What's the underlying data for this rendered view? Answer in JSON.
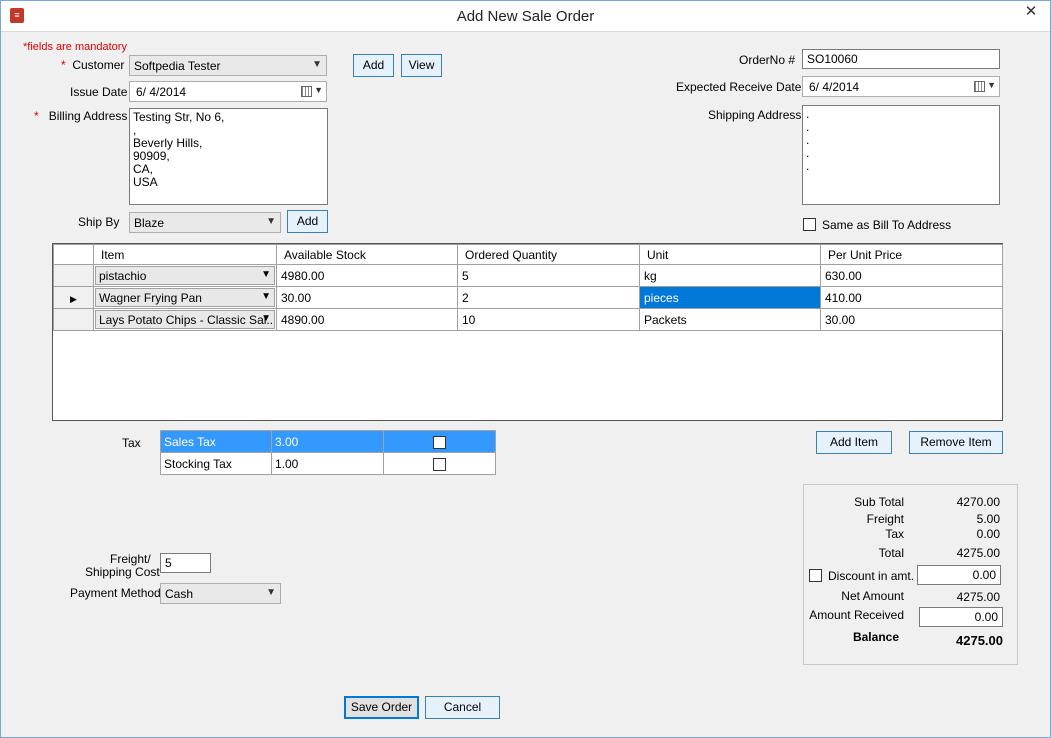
{
  "window": {
    "title": "Add New Sale Order",
    "close_glyph": "✕"
  },
  "form": {
    "mandatory_note": "fields are mandatory",
    "asterisk": "*",
    "customer_label": "Customer",
    "customer_value": "Softpedia Tester",
    "add_customer_label": "Add",
    "view_customer_label": "View",
    "issue_date_label": "Issue Date",
    "issue_date_value": "6/ 4/2014",
    "billing_address_label": "Billing Address",
    "billing_address_value": "Testing Str, No 6,\n,\nBeverly Hills,\n90909,\nCA,\nUSA",
    "ship_by_label": "Ship By",
    "ship_by_value": "Blaze",
    "add_ship_label": "Add",
    "order_no_label": "OrderNo #",
    "order_no_value": "SO10060",
    "expected_date_label": "Expected Receive Date",
    "expected_date_value": "6/ 4/2014",
    "shipping_address_label": "Shipping Address",
    "shipping_address_value": ".\n.\n.\n.\n.",
    "same_as_bill_label": "Same as Bill To Address"
  },
  "items_grid": {
    "columns": [
      "Item",
      "Available Stock",
      "Ordered Quantity",
      "Unit",
      "Per Unit Price"
    ],
    "current_row_indicator": "▶",
    "rows": [
      {
        "item": "pistachio",
        "stock": "4980.00",
        "qty": "5",
        "unit": "kg",
        "price": "630.00"
      },
      {
        "item": "Wagner Frying Pan",
        "stock": "30.00",
        "qty": "2",
        "unit": "pieces",
        "price": "410.00"
      },
      {
        "item": "Lays Potato Chips - Classic Sal...",
        "stock": "4890.00",
        "qty": "10",
        "unit": "Packets",
        "price": "30.00"
      }
    ]
  },
  "tax": {
    "label": "Tax",
    "rows": [
      {
        "name": "Sales Tax",
        "rate": "3.00"
      },
      {
        "name": "Stocking Tax",
        "rate": "1.00"
      }
    ]
  },
  "actions": {
    "add_item_label": "Add Item",
    "remove_item_label": "Remove Item",
    "save_label": "Save Order",
    "cancel_label": "Cancel"
  },
  "freight": {
    "label_line1": "Freight/",
    "label_line2": "Shipping Cost",
    "value": "5",
    "payment_method_label": "Payment Method",
    "payment_method_value": "Cash"
  },
  "summary": {
    "subtotal_label": "Sub Total",
    "subtotal": "4270.00",
    "freight_label": "Freight",
    "freight": "5.00",
    "tax_label": "Tax",
    "tax": "0.00",
    "total_label": "Total",
    "total": "4275.00",
    "discount_label": "Discount in amt.",
    "discount": "0.00",
    "net_label": "Net Amount",
    "net": "4275.00",
    "received_label": "Amount Received",
    "received": "0.00",
    "balance_label": "Balance",
    "balance": "4275.00"
  },
  "colors": {
    "selection": "#0078d7",
    "tax_selection": "#3399ff",
    "required": "#e00000"
  }
}
